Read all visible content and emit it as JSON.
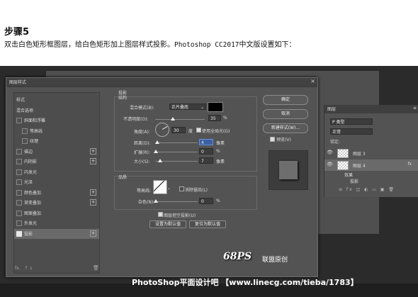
{
  "article": {
    "step_title": "步骤5",
    "description_a": "双击白色矩形框图层，给白色矩形加上图层样式投影。",
    "description_b": "Photoshop CC2017",
    "description_c": "中文版设置如下："
  },
  "dialog": {
    "title": "图层样式",
    "close": "×",
    "styles": [
      {
        "label": "样式",
        "checkbox": false,
        "plus": false,
        "indent": 0
      },
      {
        "label": "混合选项",
        "checkbox": false,
        "plus": false,
        "indent": 0
      },
      {
        "label": "斜面和浮雕",
        "checkbox": true,
        "checked": false,
        "plus": false,
        "indent": 0
      },
      {
        "label": "等高线",
        "checkbox": true,
        "checked": false,
        "plus": false,
        "indent": 1
      },
      {
        "label": "纹理",
        "checkbox": true,
        "checked": false,
        "plus": false,
        "indent": 1
      },
      {
        "label": "描边",
        "checkbox": true,
        "checked": false,
        "plus": true,
        "indent": 0
      },
      {
        "label": "内阴影",
        "checkbox": true,
        "checked": false,
        "plus": true,
        "indent": 0
      },
      {
        "label": "内发光",
        "checkbox": true,
        "checked": false,
        "plus": false,
        "indent": 0
      },
      {
        "label": "光泽",
        "checkbox": true,
        "checked": false,
        "plus": false,
        "indent": 0
      },
      {
        "label": "颜色叠加",
        "checkbox": true,
        "checked": false,
        "plus": true,
        "indent": 0
      },
      {
        "label": "渐变叠加",
        "checkbox": true,
        "checked": false,
        "plus": true,
        "indent": 0
      },
      {
        "label": "图案叠加",
        "checkbox": true,
        "checked": false,
        "plus": false,
        "indent": 0
      },
      {
        "label": "外发光",
        "checkbox": true,
        "checked": false,
        "plus": false,
        "indent": 0
      },
      {
        "label": "投影",
        "checkbox": true,
        "checked": true,
        "plus": true,
        "indent": 0,
        "selected": true
      }
    ],
    "footer_fx": "fx.",
    "footer_arrows": "↑ ↓",
    "trash": "🗑",
    "shadow": {
      "section": "投影",
      "structure": "结构",
      "blend_mode_label": "混合模式(B):",
      "blend_mode": "正片叠底",
      "opacity_label": "不透明度(O):",
      "opacity": "35",
      "pct": "%",
      "opacity_value": 0.35,
      "angle_label": "角度(A):",
      "angle": "30",
      "deg": "度",
      "global_light": "使用全局光(G)",
      "distance_label": "距离(D):",
      "distance": "4",
      "size_unit": "像素",
      "spread_label": "扩展(R):",
      "spread": "0",
      "size_label": "大小(S):",
      "size": "7",
      "quality": "品质",
      "contour_label": "等高线:",
      "antialias": "消除锯齿(L)",
      "noise_label": "杂色(N):",
      "noise": "0",
      "knockout": "图层挖空投影(U)",
      "set_default": "设置为默认值",
      "reset_default": "复位为默认值"
    },
    "buttons": {
      "ok": "确定",
      "cancel": "取消",
      "new_style": "新建样式(W)...",
      "preview": "预览(V)"
    }
  },
  "layers_panel": {
    "tab": "图层",
    "menu": "≡",
    "kind": "P 类型",
    "blend": "正常",
    "lock": "锁定:",
    "layer3": "图层 3",
    "layer4": "图层 4",
    "effects": "效果",
    "shadow": "投影",
    "fx": "fx",
    "footer_icons": "⊖ fx ◫ ◐ ▭ ▣ 🗑"
  },
  "watermark": {
    "logo": "68PS",
    "logo_sub": "联盟原创",
    "footer": "PhotoShop平面设计吧 【www.linecg.com/tieba/1783】"
  },
  "colors": {
    "ui_dark": "#535353",
    "accent_blue": "#3a5fa3",
    "shadow_color": "#000000"
  }
}
